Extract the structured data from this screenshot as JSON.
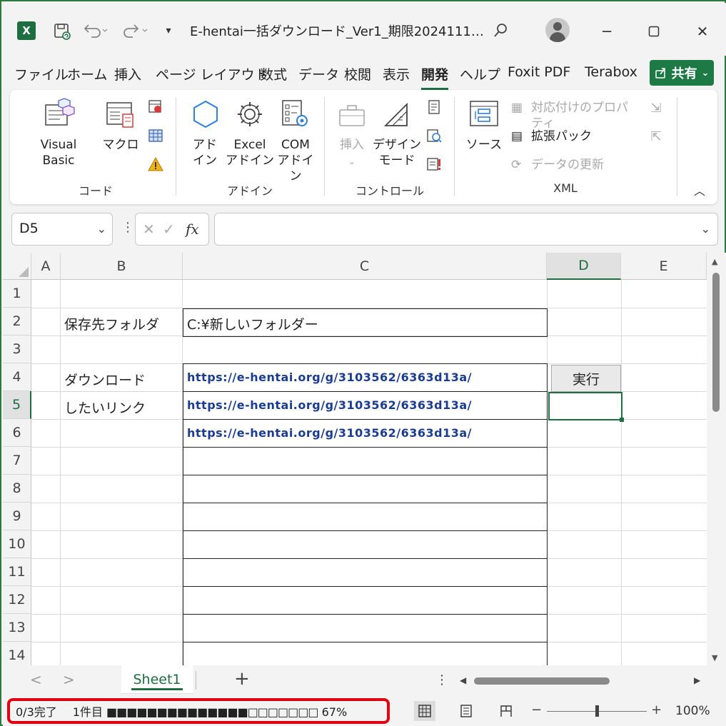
{
  "window": {
    "title": "E-hentai一括ダウンロード_Ver1_期限2024111…",
    "excel_logo": "X",
    "icons": [
      "excel-logo-icon",
      "save-icon",
      "undo-icon",
      "redo-icon",
      "customize-qat-icon",
      "search-icon",
      "account-avatar-icon",
      "minimize-icon",
      "maximize-icon",
      "close-icon"
    ]
  },
  "tabs": [
    "ファイル",
    "ホーム",
    "挿入",
    "ページ レイアウト",
    "数式",
    "データ",
    "校閲",
    "表示",
    "開発",
    "ヘルプ",
    "Foxit PDF",
    "Terabox"
  ],
  "active_tab": "開発",
  "share": {
    "label": "共有",
    "icon": "share-icon"
  },
  "ribbon": {
    "code": {
      "label": "コード",
      "visual_basic": "Visual Basic",
      "macro": "マクロ",
      "small_icons": [
        "record-macro-icon",
        "relative-reference-icon",
        "macro-security-icon"
      ]
    },
    "addin": {
      "label": "アドイン",
      "addin_1": "アド",
      "addin_2": "イン",
      "excel_1": "Excel",
      "excel_2": "アドイン",
      "com_1": "COM",
      "com_2": "アドイン"
    },
    "control": {
      "label": "コントロール",
      "insert": "挿入",
      "design_1": "デザイン",
      "design_2": "モード",
      "small_icons": [
        "properties-icon",
        "view-code-icon",
        "run-dialog-icon"
      ]
    },
    "xml": {
      "label": "XML",
      "source": "ソース",
      "map_properties": "対応付けのプロパティ",
      "expansion_pack": "拡張パック",
      "refresh_data": "データの更新",
      "small_icons": [
        "import-icon",
        "export-icon"
      ]
    }
  },
  "formula_bar": {
    "name_box": "D5",
    "fx": "fx",
    "value": ""
  },
  "sheet": {
    "columns": [
      "A",
      "B",
      "C",
      "D",
      "E"
    ],
    "selected_column": "D",
    "rows": [
      "1",
      "2",
      "3",
      "4",
      "5",
      "6",
      "7",
      "8",
      "9",
      "10",
      "11",
      "12",
      "13",
      "14"
    ],
    "selected_row": "5",
    "b2": "保存先フォルダ",
    "c2": "C:¥新しいフォルダー",
    "b4": "ダウンロード",
    "b5": "したいリンク",
    "links": [
      "https://e-hentai.org/g/3103562/6363d13a/",
      "https://e-hentai.org/g/3103562/6363d13a/",
      "https://e-hentai.org/g/3103562/6363d13a/"
    ],
    "execute_button": "実行"
  },
  "sheet_tabs": {
    "nav_prev": "<",
    "nav_next": ">",
    "active": "Sheet1",
    "add": "+",
    "more": "⋮"
  },
  "status": {
    "progress_text": "0/3完了",
    "item_text": "1件目",
    "progress_fraction": 0.67,
    "progress_bar": "■■■■■■■■■■■■■■□□□□□□□",
    "percent": "67%",
    "zoom": "100%",
    "zoom_level": 1.0,
    "view_icons": [
      "normal-view-icon",
      "page-layout-view-icon",
      "page-break-preview-icon"
    ]
  }
}
